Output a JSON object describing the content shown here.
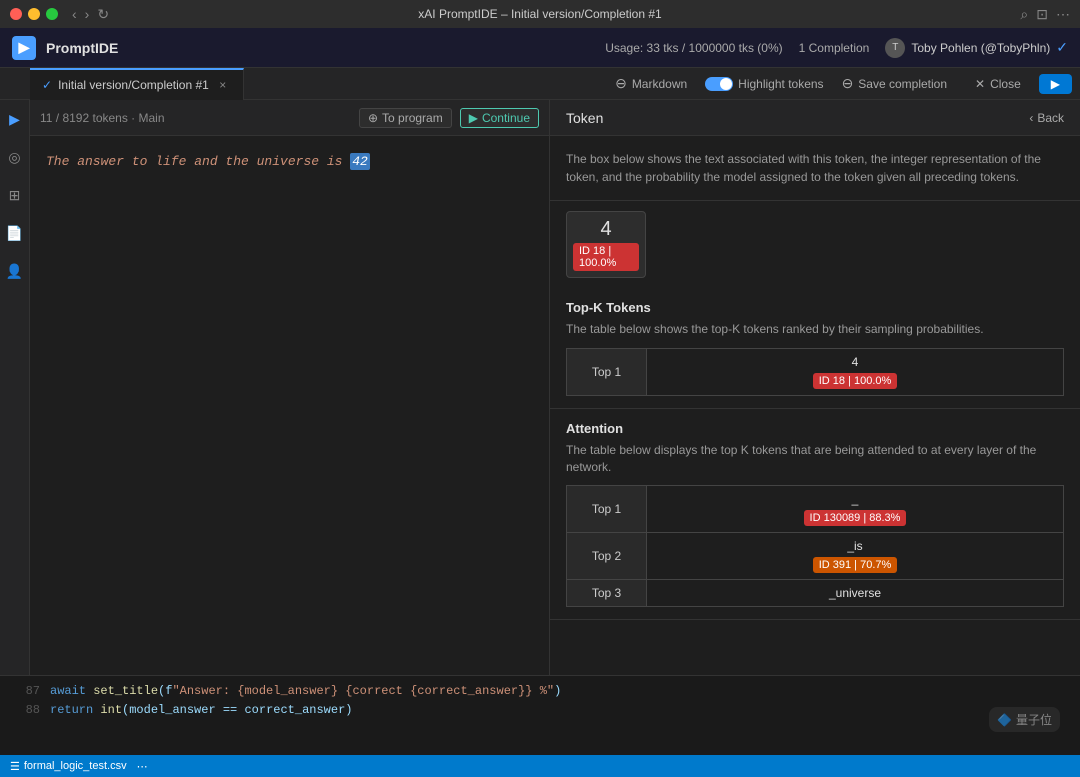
{
  "titlebar": {
    "title": "xAI PromptIDE – Initial version/Completion #1",
    "controls": [
      "red",
      "yellow",
      "green"
    ]
  },
  "app_header": {
    "logo_letter": "▶",
    "app_name": "PromptIDE",
    "usage_text": "Usage: 33 tks / 1000000 tks (0%)",
    "completions_text": "1 Completion",
    "user_name": "Toby Pohlen (@TobyPhln)"
  },
  "tabs": [
    {
      "label": "Initial version/Completion #1",
      "active": true
    }
  ],
  "toolbar": {
    "markdown_label": "Markdown",
    "highlight_label": "Highlight tokens",
    "save_label": "Save completion",
    "close_label": "Close"
  },
  "left_panel": {
    "info_text": "11 / 8192 tokens · Main",
    "to_program_label": "To program",
    "continue_label": "Continue",
    "editor_text": "The answer to life and the universe is ",
    "highlighted_token": "42"
  },
  "right_panel": {
    "title": "Token",
    "back_label": "Back",
    "description": "The box below shows the text associated with this token, the integer representation of the token, and the probability the model assigned to the token given all preceding tokens.",
    "token_value": "4",
    "token_id": "ID 18 | 100.0%",
    "topk_section": {
      "title": "Top-K Tokens",
      "description": "The table below shows the top-K tokens ranked by their sampling probabilities.",
      "rows": [
        {
          "label": "Top 1",
          "value": "4",
          "badge": "ID 18 | 100.0%"
        }
      ]
    },
    "attention_section": {
      "title": "Attention",
      "description": "The table below displays the top K tokens that are being attended to at every layer of the network.",
      "rows": [
        {
          "label": "Top 1",
          "value": "_",
          "badge": "ID 130089 | 88.3%"
        },
        {
          "label": "Top 2",
          "value": "_is",
          "badge": "ID 391 | 70.7%"
        },
        {
          "label": "Top 3",
          "value": "_universe",
          "badge": ""
        }
      ]
    }
  },
  "bottom_code": {
    "lines": [
      {
        "num": "87",
        "content": "await set_title(f\"Answer: {model_answer} {correct {correct_answer}} %\")"
      },
      {
        "num": "88",
        "content": "return int(model_answer == correct_answer)"
      }
    ]
  },
  "file_info": {
    "file_name": "formal_logic_test.csv"
  }
}
